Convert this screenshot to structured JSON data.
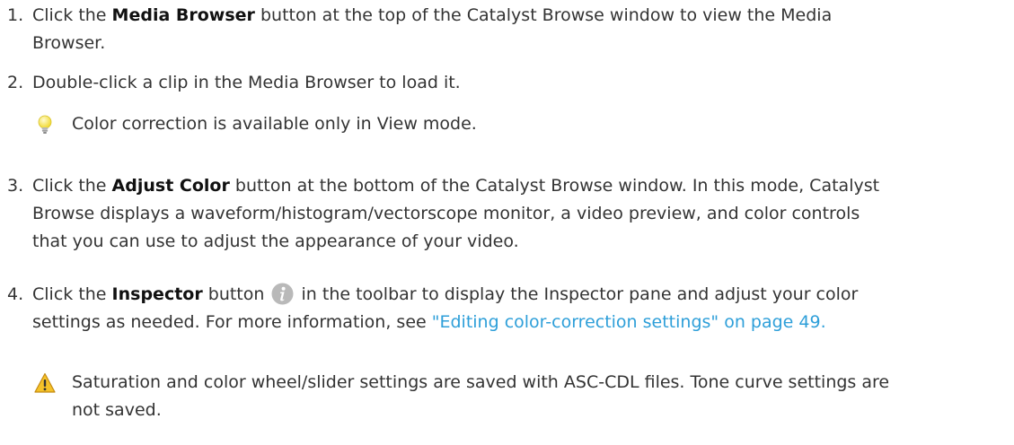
{
  "steps": [
    {
      "number": "1.",
      "pre": "Click the ",
      "bold": "Media Browser",
      "post_line1": " button at the top of the Catalyst Browse window to view the Media",
      "line2": "Browser."
    },
    {
      "number": "2.",
      "text": "Double-click a clip in the Media Browser to load it."
    },
    {
      "number": "3.",
      "pre": "Click the ",
      "bold": "Adjust Color",
      "post_line1": " button at the bottom of the Catalyst Browse window. In this mode, Catalyst",
      "line2": "Browse displays a waveform/histogram/vectorscope monitor, a video preview, and color controls",
      "line3": "that you can use to adjust the appearance of your video."
    },
    {
      "number": "4.",
      "pre": "Click the ",
      "bold": "Inspector",
      "mid": " button ",
      "post_line1": " in the toolbar to display the Inspector pane and adjust your color",
      "line2_pre": "settings as needed. For more information, see ",
      "link": "\"Editing color-correction settings\" on page 49.",
      "icon": "info-icon"
    }
  ],
  "tip": {
    "icon": "lightbulb-icon",
    "text": "Color correction is available only in View mode."
  },
  "warning": {
    "icon": "warning-icon",
    "line1": "Saturation and color wheel/slider settings are saved with ASC-CDL files. Tone curve settings are",
    "line2": "not saved."
  },
  "colors": {
    "link": "#2e9fd9",
    "info_icon": "#b9b9b9",
    "warning": "#f2b820",
    "bulb": "#f7e86a"
  }
}
